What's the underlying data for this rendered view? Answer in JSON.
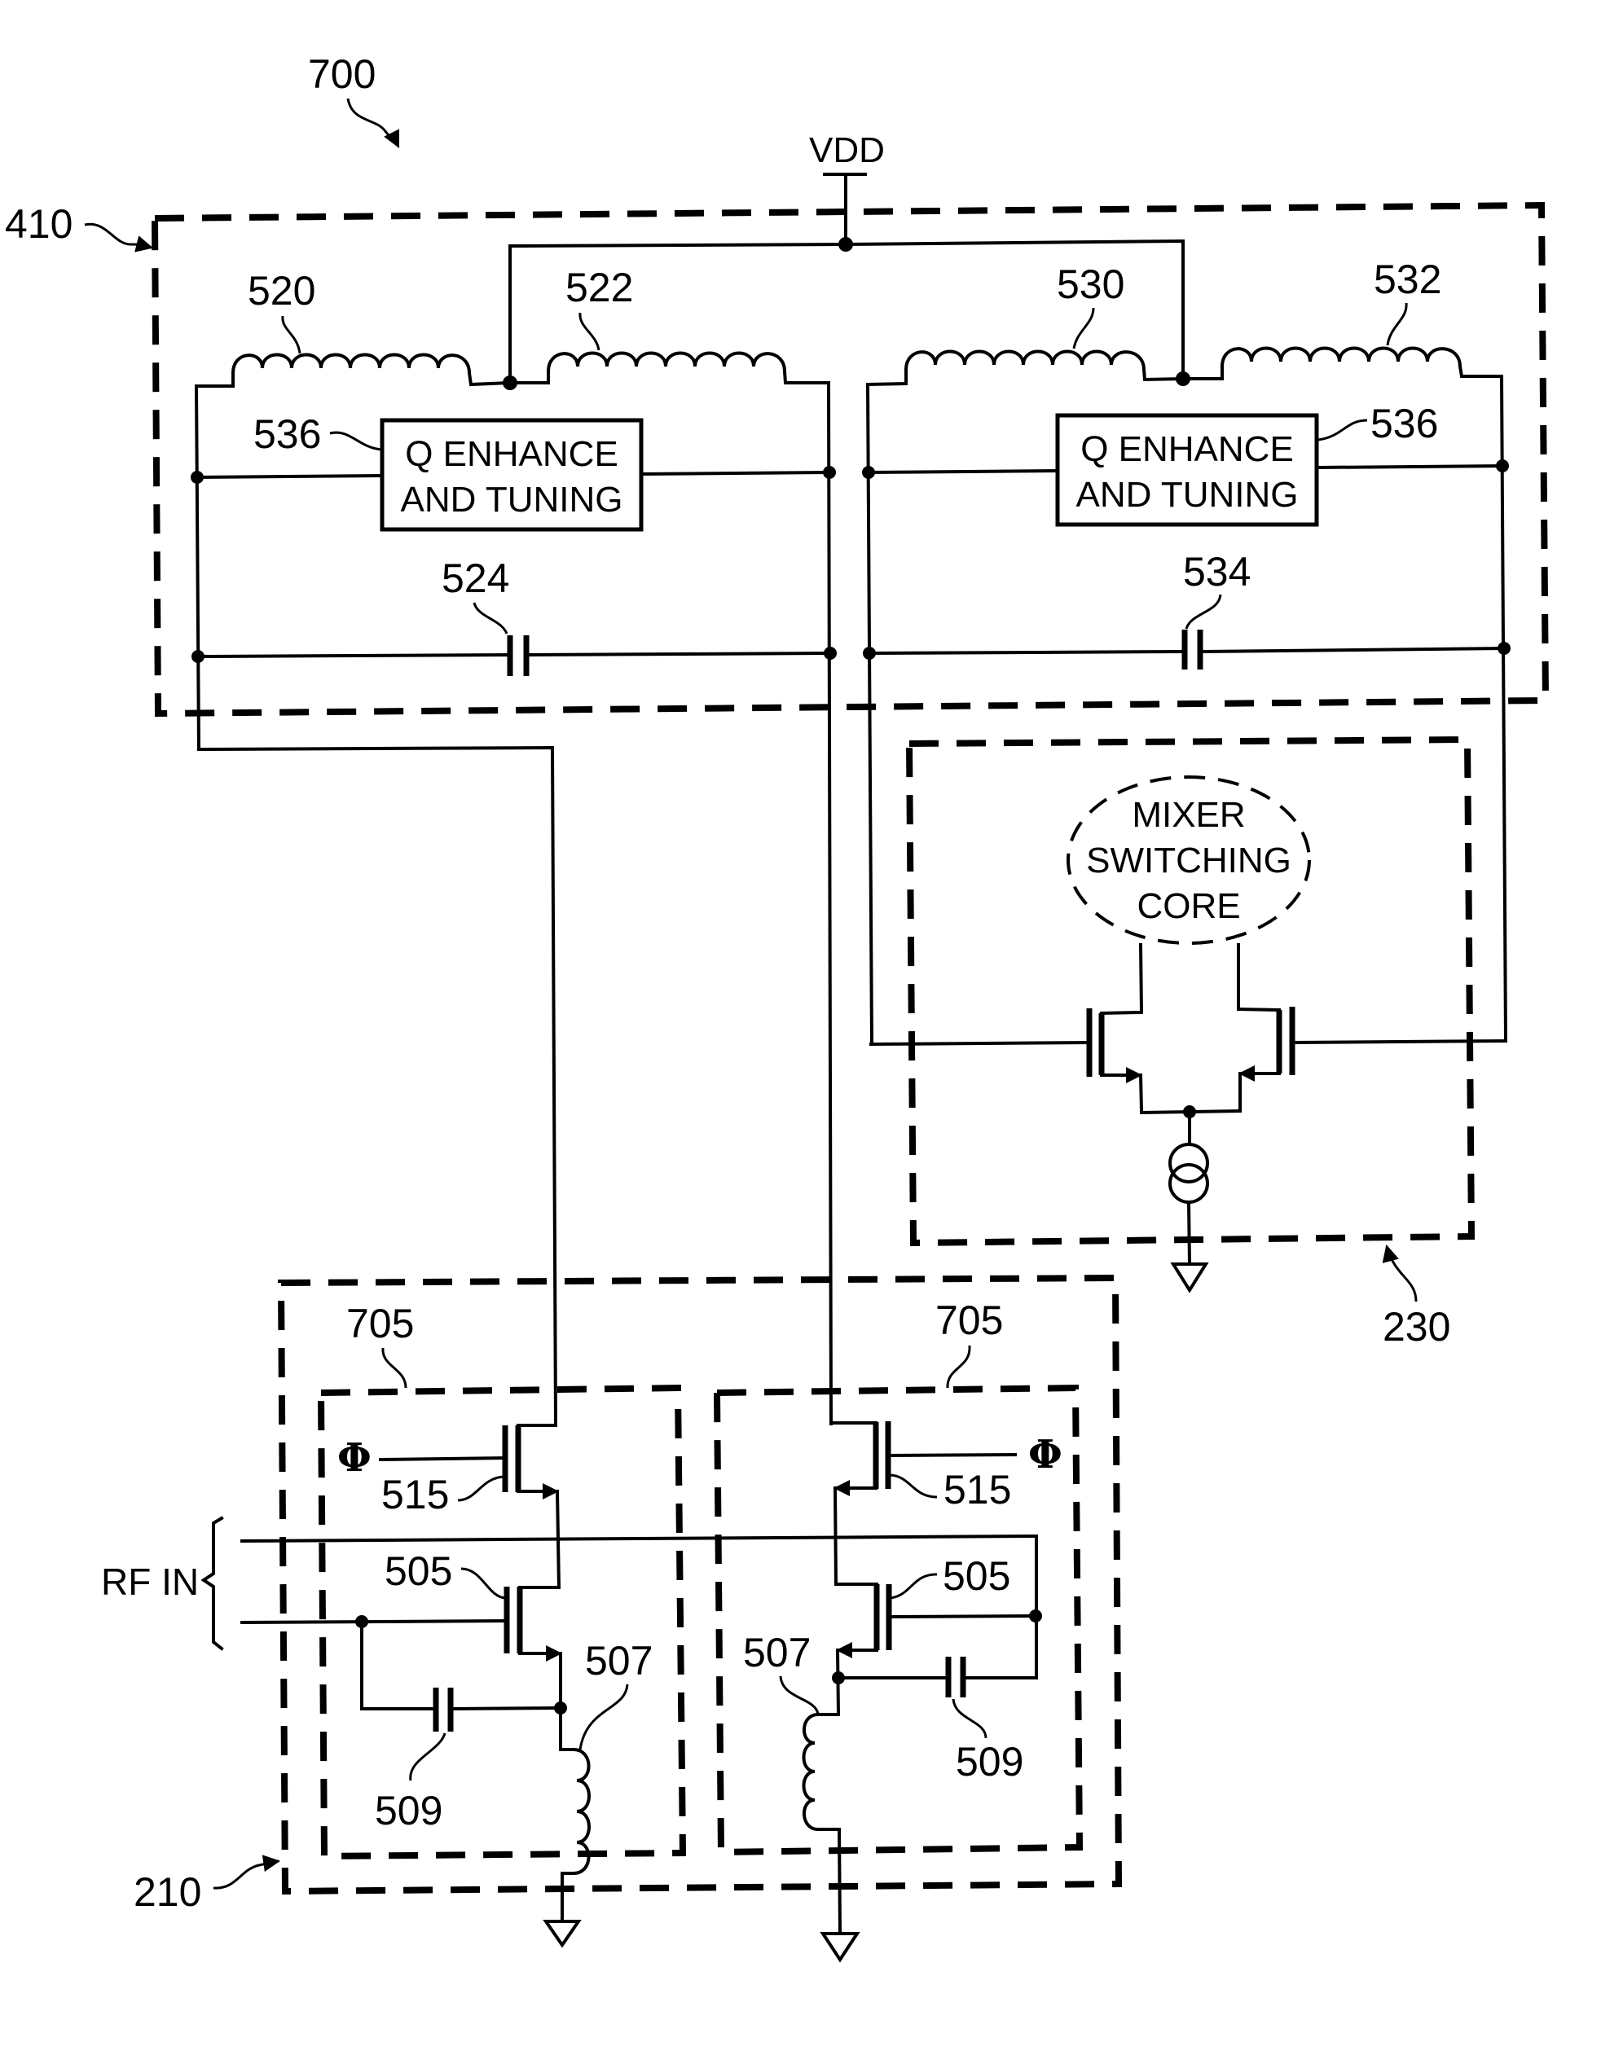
{
  "figure": {
    "reference": "700",
    "supply_label": "VDD",
    "blocks": {
      "load_tank": {
        "reference": "410"
      },
      "mixer": {
        "reference": "230",
        "core_lines": [
          "MIXER",
          "SWITCHING",
          "CORE"
        ]
      },
      "lna": {
        "reference": "210",
        "cell_reference": "705",
        "input_label": "RF IN"
      }
    },
    "components": {
      "inductor_520": "520",
      "inductor_522": "522",
      "inductor_530": "530",
      "inductor_532": "532",
      "capacitor_524": "524",
      "capacitor_534": "534",
      "q_block_ref": "536",
      "q_block_line1": "Q ENHANCE",
      "q_block_line2": "AND TUNING",
      "transistor_505": "505",
      "transistor_515": "515",
      "inductor_507": "507",
      "capacitor_509": "509",
      "phase_symbol": "Φ"
    }
  }
}
